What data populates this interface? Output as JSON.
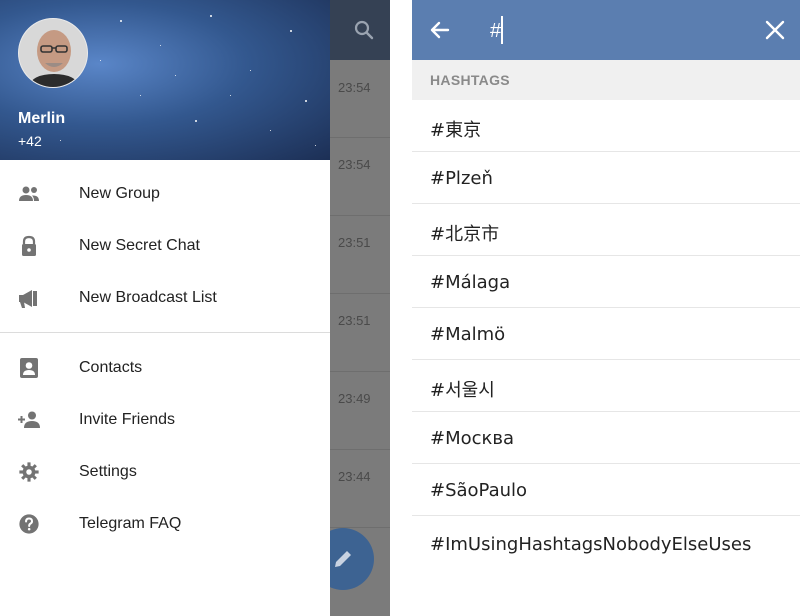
{
  "left_screen": {
    "background_chat": {
      "times": [
        "23:54",
        "23:54",
        "23:51",
        "23:51",
        "23:49",
        "23:44"
      ]
    },
    "drawer": {
      "user_name": "Merlin",
      "user_phone": "+42",
      "menu_primary": [
        {
          "label": "New Group",
          "icon": "group-icon"
        },
        {
          "label": "New Secret Chat",
          "icon": "lock-icon"
        },
        {
          "label": "New Broadcast List",
          "icon": "megaphone-icon"
        }
      ],
      "menu_secondary": [
        {
          "label": "Contacts",
          "icon": "contacts-icon"
        },
        {
          "label": "Invite Friends",
          "icon": "add-person-icon"
        },
        {
          "label": "Settings",
          "icon": "gear-icon"
        },
        {
          "label": "Telegram FAQ",
          "icon": "help-icon"
        }
      ]
    }
  },
  "right_screen": {
    "search": {
      "value": "#"
    },
    "section_title": "HASHTAGS",
    "hashtags": [
      "#東京",
      "#Plzeň",
      "#北京市",
      "#Málaga",
      "#Malmö",
      "#서울시",
      "#Москва",
      "#SãoPaulo",
      "#ImUsingHashtagsNobodyElseUses"
    ]
  },
  "colors": {
    "drawer_header": "#33588f",
    "search_toolbar": "#5b7eb0",
    "dim_overlay": "#7b7b7b",
    "fab": "#3d6392"
  }
}
